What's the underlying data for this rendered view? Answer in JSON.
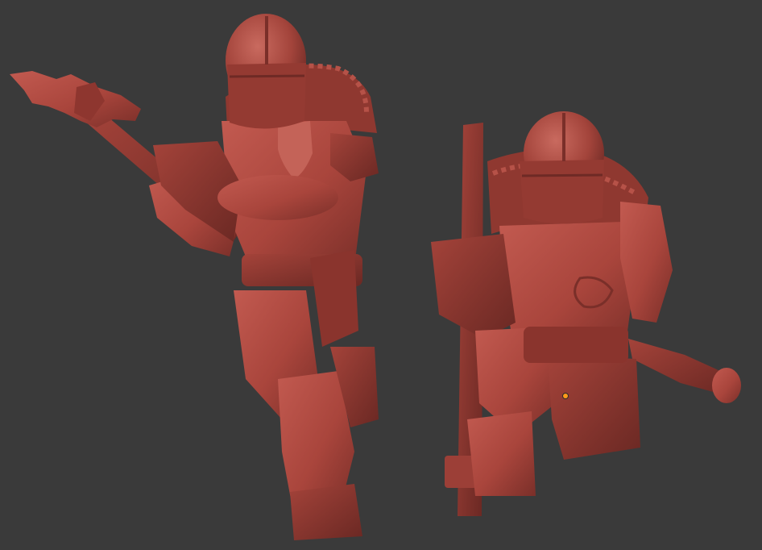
{
  "viewport": {
    "background_color": "#3a3a3a",
    "clay_color": "#a9453c",
    "clay_shadow_color": "#6e2a25",
    "clay_highlight_color": "#c9655a",
    "origin_marker_color": "#ff9a1a"
  },
  "models": [
    {
      "name": "armored-soldier-with-axe",
      "pose": "standing",
      "weapon": "double-headed-axe-icon"
    },
    {
      "name": "armored-soldier-with-mace",
      "pose": "kneeling",
      "weapon": "mace-icon"
    }
  ]
}
